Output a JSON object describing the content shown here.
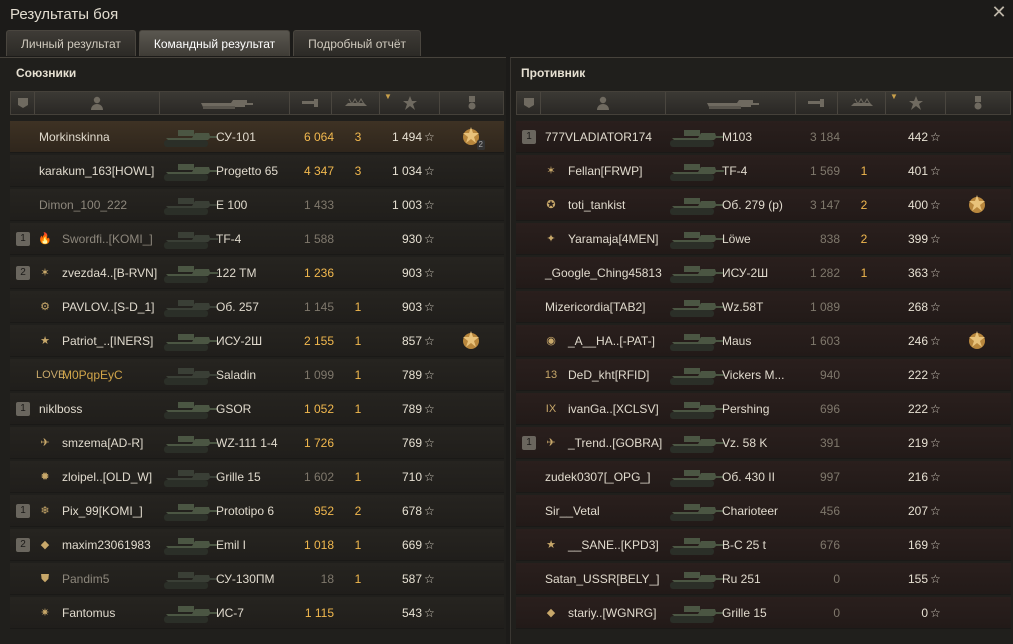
{
  "window": {
    "title": "Результаты боя",
    "close": "✕"
  },
  "tabs": [
    {
      "label": "Личный результат",
      "active": false
    },
    {
      "label": "Командный результат",
      "active": true
    },
    {
      "label": "Подробный отчёт",
      "active": false
    }
  ],
  "allies": {
    "title": "Союзники",
    "rows": [
      {
        "squad": "",
        "player": "Morkinskinna",
        "tank": "СУ-101",
        "damage": "6 064",
        "kills": "3",
        "xp": "1 494",
        "medal": true,
        "medal_count": "2",
        "highlight": true,
        "name_style": "normal",
        "dmg_dim": false,
        "emblem": ""
      },
      {
        "squad": "",
        "player": "karakum_163[HOWL]",
        "tank": "Progetto 65",
        "damage": "4 347",
        "kills": "3",
        "xp": "1 034",
        "medal": false,
        "name_style": "normal",
        "dmg_dim": false,
        "emblem": ""
      },
      {
        "squad": "",
        "player": "Dimon_100_222",
        "tank": "E 100",
        "damage": "1 433",
        "kills": "",
        "xp": "1 003",
        "medal": false,
        "name_style": "dim",
        "dmg_dim": true,
        "emblem": ""
      },
      {
        "squad": "1",
        "player": "Swordfi..[KOMI_]",
        "tank": "TF-4",
        "damage": "1 588",
        "kills": "",
        "xp": "930",
        "medal": false,
        "name_style": "dim",
        "dmg_dim": true,
        "emblem": "🔥"
      },
      {
        "squad": "2",
        "player": "zvezda4..[B-RVN]",
        "tank": "122 TM",
        "damage": "1 236",
        "kills": "",
        "xp": "903",
        "medal": false,
        "name_style": "normal",
        "dmg_dim": false,
        "emblem": "✶"
      },
      {
        "squad": "",
        "player": "PAVLOV..[S-D_1]",
        "tank": "Об. 257",
        "damage": "1 145",
        "kills": "1",
        "xp": "903",
        "medal": false,
        "name_style": "normal",
        "dmg_dim": true,
        "emblem": "⚙"
      },
      {
        "squad": "",
        "player": "Patriot_..[INERS]",
        "tank": "ИСУ-2Ш",
        "damage": "2 155",
        "kills": "1",
        "xp": "857",
        "medal": true,
        "medal_count": "",
        "name_style": "normal",
        "dmg_dim": false,
        "emblem": "★"
      },
      {
        "squad": "",
        "player": "M0PqpEyC",
        "tank": "Saladin",
        "damage": "1 099",
        "kills": "1",
        "xp": "789",
        "medal": false,
        "name_style": "gold",
        "dmg_dim": true,
        "emblem": "LOVE"
      },
      {
        "squad": "1",
        "player": "niklboss",
        "tank": "GSOR",
        "damage": "1 052",
        "kills": "1",
        "xp": "789",
        "medal": false,
        "name_style": "normal",
        "dmg_dim": false,
        "emblem": ""
      },
      {
        "squad": "",
        "player": "smzema[AD-R]",
        "tank": "WZ-111 1-4",
        "damage": "1 726",
        "kills": "",
        "xp": "769",
        "medal": false,
        "name_style": "normal",
        "dmg_dim": false,
        "emblem": "✈"
      },
      {
        "squad": "",
        "player": "zloipel..[OLD_W]",
        "tank": "Grille 15",
        "damage": "1 602",
        "kills": "1",
        "xp": "710",
        "medal": false,
        "name_style": "normal",
        "dmg_dim": true,
        "emblem": "✹"
      },
      {
        "squad": "1",
        "player": "Pix_99[KOMI_]",
        "tank": "Prototipo 6",
        "damage": "952",
        "kills": "2",
        "xp": "678",
        "medal": false,
        "name_style": "normal",
        "dmg_dim": false,
        "emblem": "❄"
      },
      {
        "squad": "2",
        "player": "maxim23061983",
        "tank": "Emil I",
        "damage": "1 018",
        "kills": "1",
        "xp": "669",
        "medal": false,
        "name_style": "normal",
        "dmg_dim": false,
        "emblem": "◆"
      },
      {
        "squad": "",
        "player": "Pandim5",
        "tank": "СУ-130ПМ",
        "damage": "18",
        "kills": "1",
        "xp": "587",
        "medal": false,
        "name_style": "dim",
        "dmg_dim": true,
        "emblem": "⛊"
      },
      {
        "squad": "",
        "player": "Fantomus",
        "tank": "ИС-7",
        "damage": "1 115",
        "kills": "",
        "xp": "543",
        "medal": false,
        "name_style": "normal",
        "dmg_dim": false,
        "emblem": "✷"
      }
    ]
  },
  "enemies": {
    "title": "Противник",
    "rows": [
      {
        "squad": "1",
        "player": "777VLADIATOR174",
        "tank": "M103",
        "damage": "3 184",
        "kills": "",
        "xp": "442",
        "medal": false,
        "name_style": "normal",
        "emblem": ""
      },
      {
        "squad": "",
        "player": "Fellan[FRWP]",
        "tank": "TF-4",
        "damage": "1 569",
        "kills": "1",
        "xp": "401",
        "medal": false,
        "name_style": "normal",
        "emblem": "✶"
      },
      {
        "squad": "",
        "player": "toti_tankist",
        "tank": "Об. 279 (р)",
        "damage": "3 147",
        "kills": "2",
        "xp": "400",
        "medal": true,
        "name_style": "normal",
        "emblem": "✪"
      },
      {
        "squad": "",
        "player": "Yaramaja[4MEN]",
        "tank": "Löwe",
        "damage": "838",
        "kills": "2",
        "xp": "399",
        "medal": false,
        "name_style": "normal",
        "emblem": "✦"
      },
      {
        "squad": "",
        "player": "_Google_Ching45813",
        "tank": "ИСУ-2Ш",
        "damage": "1 282",
        "kills": "1",
        "xp": "363",
        "medal": false,
        "name_style": "normal",
        "emblem": ""
      },
      {
        "squad": "",
        "player": "Mizericordia[TAB2]",
        "tank": "Wz.58T",
        "damage": "1 089",
        "kills": "",
        "xp": "268",
        "medal": false,
        "name_style": "normal",
        "emblem": ""
      },
      {
        "squad": "",
        "player": "_A__HA..[-PAT-]",
        "tank": "Maus",
        "damage": "1 603",
        "kills": "",
        "xp": "246",
        "medal": true,
        "name_style": "normal",
        "emblem": "◉"
      },
      {
        "squad": "",
        "player": "DeD_kht[RFID]",
        "tank": "Vickers M...",
        "damage": "940",
        "kills": "",
        "xp": "222",
        "medal": false,
        "name_style": "normal",
        "emblem": "13"
      },
      {
        "squad": "",
        "player": "ivanGa..[XCLSV]",
        "tank": "Pershing",
        "damage": "696",
        "kills": "",
        "xp": "222",
        "medal": false,
        "name_style": "normal",
        "emblem": "IX"
      },
      {
        "squad": "1",
        "player": "_Trend..[GOBRA]",
        "tank": "Vz. 58 K",
        "damage": "391",
        "kills": "",
        "xp": "219",
        "medal": false,
        "name_style": "normal",
        "emblem": "✈"
      },
      {
        "squad": "",
        "player": "zudek0307[_OPG_]",
        "tank": "Об. 430 II",
        "damage": "997",
        "kills": "",
        "xp": "216",
        "medal": false,
        "name_style": "normal",
        "emblem": ""
      },
      {
        "squad": "",
        "player": "Sir__Vetal",
        "tank": "Charioteer",
        "damage": "456",
        "kills": "",
        "xp": "207",
        "medal": false,
        "name_style": "normal",
        "emblem": ""
      },
      {
        "squad": "",
        "player": "__SANE..[KPD3]",
        "tank": "B-C 25 t",
        "damage": "676",
        "kills": "",
        "xp": "169",
        "medal": false,
        "name_style": "normal",
        "emblem": "★"
      },
      {
        "squad": "",
        "player": "Satan_USSR[BELY_]",
        "tank": "Ru 251",
        "damage": "0",
        "kills": "",
        "xp": "155",
        "medal": false,
        "name_style": "normal",
        "emblem": ""
      },
      {
        "squad": "",
        "player": "stariy..[WGNRG]",
        "tank": "Grille 15",
        "damage": "0",
        "kills": "",
        "xp": "0",
        "medal": false,
        "name_style": "normal",
        "emblem": "◆"
      }
    ]
  },
  "colors": {
    "damage": "#f1b84e",
    "enemy_row": "#2a1f1d",
    "player_row": "#3e3224"
  },
  "icons": {
    "star": "☆",
    "close": "close-icon",
    "squad": "squad-icon",
    "player": "player-icon",
    "vehicle": "vehicle-icon",
    "damage": "damage-icon",
    "kills": "kills-icon",
    "xp": "star-icon",
    "medal": "medal-icon"
  }
}
